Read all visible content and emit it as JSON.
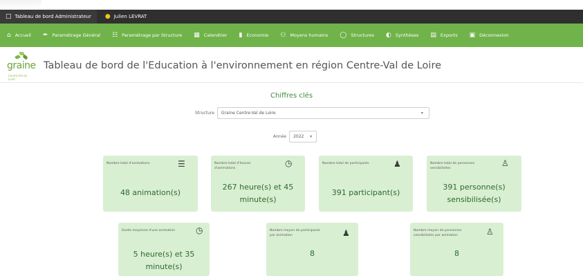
{
  "topbar": {
    "dashboard_tab": "Tableau de bord Administrateur",
    "user_name": "Julien LEVRAT"
  },
  "nav": {
    "items": [
      {
        "label": "Accueil",
        "icon": "home-icon"
      },
      {
        "label": "Paramétrage Général",
        "icon": "wrench-icon"
      },
      {
        "label": "Paramétrage par Structure",
        "icon": "sitemap-icon"
      },
      {
        "label": "Calendrier",
        "icon": "calendar-icon"
      },
      {
        "label": "Economie",
        "icon": "bar-chart-icon"
      },
      {
        "label": "Moyens humains",
        "icon": "people-icon"
      },
      {
        "label": "Structures",
        "icon": "structure-icon"
      },
      {
        "label": "Synthèses",
        "icon": "pie-chart-icon"
      },
      {
        "label": "Exports",
        "icon": "export-icon"
      },
      {
        "label": "Déconnexion",
        "icon": "logout-icon"
      }
    ]
  },
  "logo": {
    "word": "graine",
    "tagline": "Centre-Val de Loire"
  },
  "header": {
    "title": "Tableau de bord de l'Education à l'environnement en région Centre-Val de Loire"
  },
  "main": {
    "section_title": "Chiffres clés",
    "structure_label": "Structure",
    "structure_value": "Graine Centre-Val de Loire",
    "annee_label": "Année",
    "annee_value": "2022"
  },
  "cards": [
    {
      "label": "Nombre total d'animations",
      "value": "48 animation(s)",
      "icon": "database-icon"
    },
    {
      "label": "Nombre total d'heures d'animations",
      "value": "267 heure(s) et 45 minute(s)",
      "icon": "clock-icon"
    },
    {
      "label": "Nombre total de participants",
      "value": "391 participant(s)",
      "icon": "group-icon"
    },
    {
      "label": "Nombre total de personnes sensibilisées",
      "value": "391 personne(s) sensibilisée(s)",
      "icon": "user-plus-icon"
    },
    {
      "label": "Durée moyenne d'une animation",
      "value": "5 heure(s) et 35 minute(s)",
      "icon": "clock-icon"
    },
    {
      "label": "Nombre moyen de participants par animation",
      "value": "8",
      "icon": "group-icon"
    },
    {
      "label": "Nombre moyen de personnes sensibilisées par animation",
      "value": "8",
      "icon": "user-plus-icon"
    }
  ]
}
